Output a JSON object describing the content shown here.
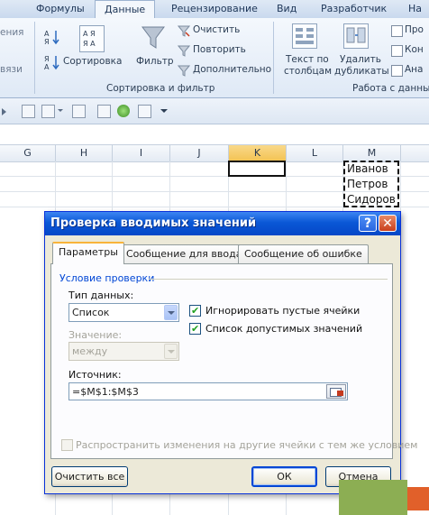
{
  "ribbon": {
    "tabs": [
      "Формулы",
      "Данные",
      "Рецензирование",
      "Вид",
      "Разработчик",
      "На"
    ],
    "active_tab": "Данные",
    "left_fragments": [
      "ения",
      "вязи"
    ],
    "sort_group": {
      "sort_label": "Сортировка",
      "filter_label": "Фильтр",
      "clear_label": "Очистить",
      "reapply_label": "Повторить",
      "advanced_label": "Дополнительно",
      "title": "Сортировка и фильтр"
    },
    "data_group": {
      "text_to_columns": [
        "Текст по",
        "столбцам"
      ],
      "remove_duplicates": [
        "Удалить",
        "дубликаты"
      ],
      "title": "Работа с данны",
      "side_items": [
        "Про",
        "Кон",
        "Ана"
      ]
    }
  },
  "sheet": {
    "columns": [
      "G",
      "H",
      "I",
      "J",
      "K",
      "L",
      "M"
    ],
    "selected_column": "K",
    "cells_m": [
      "Иванов",
      "Петров",
      "Сидоров"
    ]
  },
  "dialog": {
    "title": "Проверка вводимых значений",
    "help_glyph": "?",
    "close_glyph": "✕",
    "tabs": [
      "Параметры",
      "Сообщение для ввода",
      "Сообщение об ошибке"
    ],
    "group_label": "Условие проверки",
    "data_type_label": "Тип данных:",
    "data_type_value": "Список",
    "ignore_blank_label": "Игнорировать пустые ячейки",
    "ignore_blank_checked": true,
    "dropdown_list_label": "Список допустимых значений",
    "dropdown_list_checked": true,
    "value_label": "Значение:",
    "value_value": "между",
    "source_label": "Источник:",
    "source_value": "=$M$1:$M$3",
    "propagate_label": "Распространить изменения на другие ячейки с тем же условием",
    "propagate_checked": false,
    "clear_all_button": "Очистить все",
    "ok_button": "ОК",
    "cancel_button": "Отмена"
  },
  "colors": {
    "titlebar": "#0a57d6",
    "dialog_bg": "#ece9d8",
    "active_column": "#f3c251",
    "overlay_green": "#8cae53",
    "overlay_orange": "#e1602a"
  }
}
